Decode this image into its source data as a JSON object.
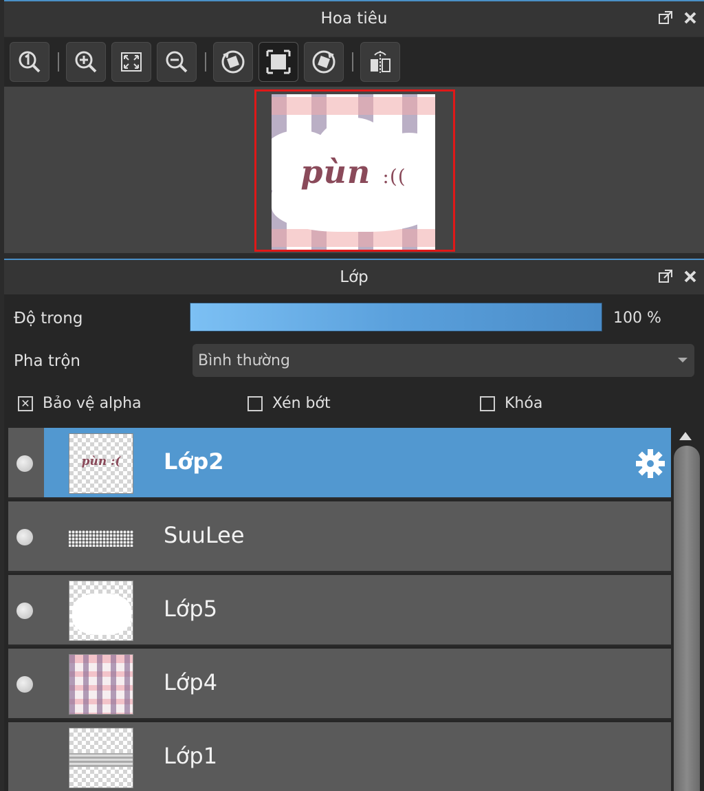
{
  "navigator": {
    "title": "Hoa tiêu",
    "toolbar_icons": [
      "zoom-actual-icon",
      "zoom-in-icon",
      "fit-screen-icon",
      "zoom-out-icon",
      "rotate-left-icon",
      "fit-canvas-icon",
      "rotate-right-icon",
      "flip-horizontal-icon"
    ],
    "preview": {
      "text_main": "pùn",
      "text_small": ":(("
    }
  },
  "layers_panel": {
    "title": "Lớp",
    "opacity_label": "Độ trong",
    "opacity_value": "100 %",
    "opacity_fraction": 1.0,
    "blend_label": "Pha trộn",
    "blend_value": "Bình thường",
    "checks": {
      "protect_alpha": {
        "label": "Bảo vệ alpha",
        "checked": true
      },
      "clipping": {
        "label": "Xén bớt",
        "checked": false
      },
      "lock": {
        "label": "Khóa",
        "checked": false
      }
    },
    "layers": [
      {
        "name": "Lớp2",
        "visible": true,
        "selected": true,
        "thumb": "text"
      },
      {
        "name": "SuuLee",
        "visible": true,
        "selected": false,
        "thumb": "signature"
      },
      {
        "name": "Lớp5",
        "visible": true,
        "selected": false,
        "thumb": "cloud"
      },
      {
        "name": "Lớp4",
        "visible": true,
        "selected": false,
        "thumb": "plaid"
      },
      {
        "name": "Lớp1",
        "visible": false,
        "selected": false,
        "thumb": "band"
      }
    ]
  },
  "colors": {
    "accent": "#4a90c8",
    "selection": "#5298d0",
    "preview_border": "#e01818"
  }
}
